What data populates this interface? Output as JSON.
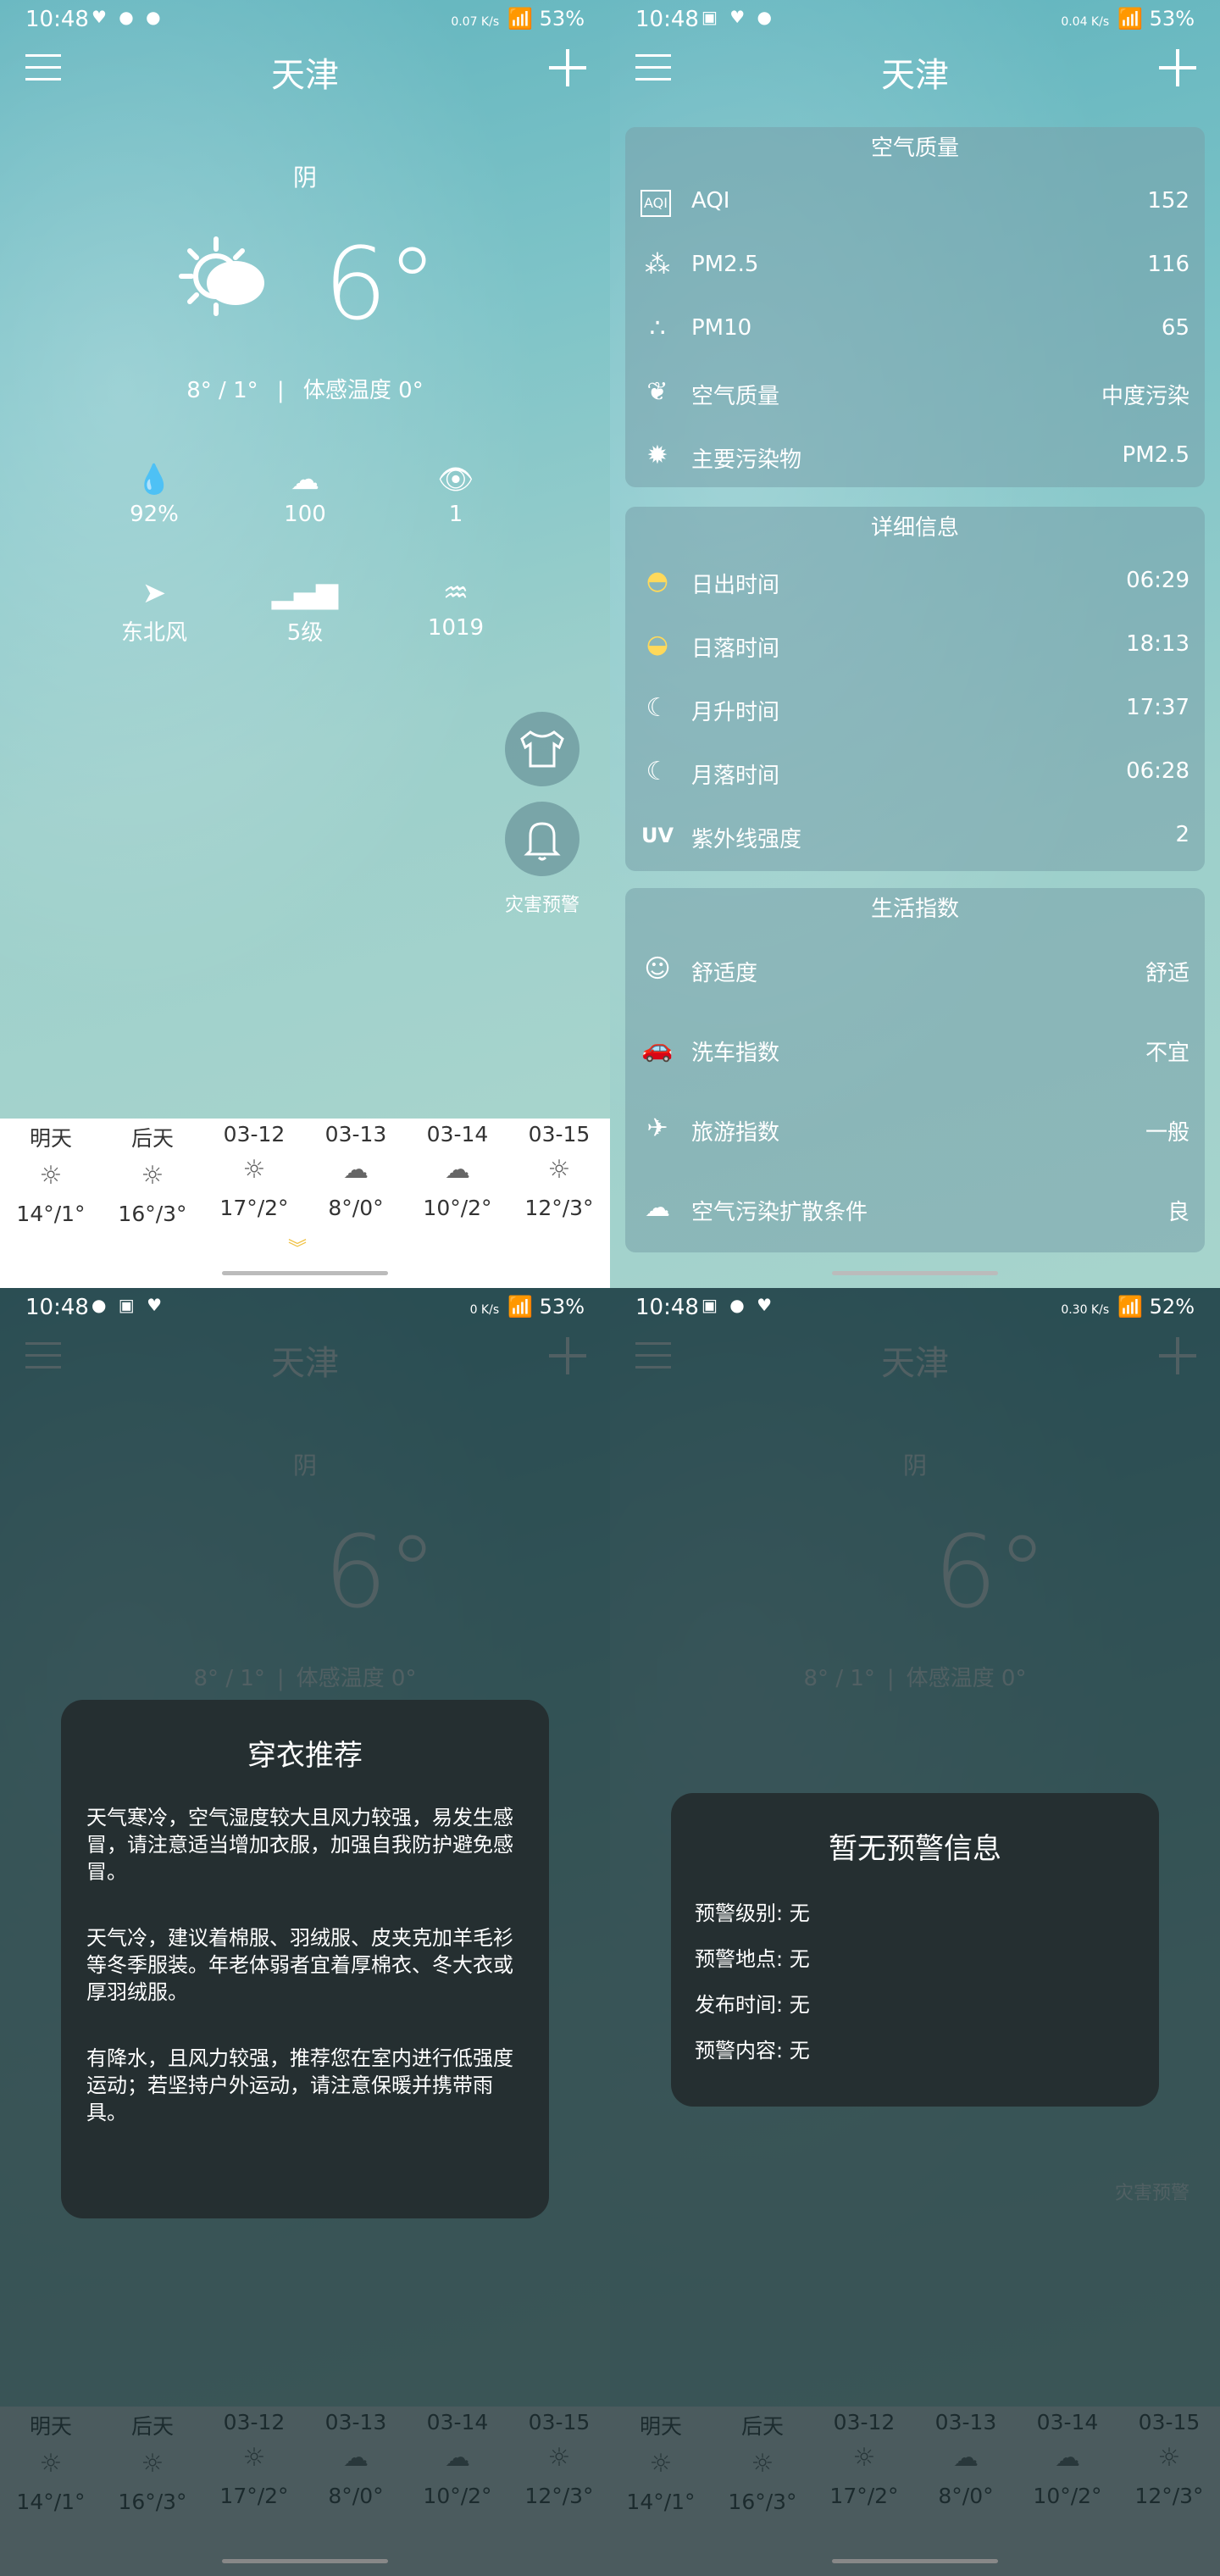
{
  "city": "天津",
  "condition": "阴",
  "temperature": "6°",
  "temp_range": "8° / 1°",
  "feels_like": "体感温度 0°",
  "stats": [
    {
      "icon": "humidity-icon",
      "value": "92%"
    },
    {
      "icon": "cloud-icon",
      "value": "100"
    },
    {
      "icon": "eye-icon",
      "value": "1"
    },
    {
      "icon": "wind-direction-icon",
      "value": "东北风"
    },
    {
      "icon": "signal-bars-icon",
      "value": "5级"
    },
    {
      "icon": "pressure-icon",
      "value": "1019"
    }
  ],
  "alert_label": "灾害预警",
  "forecast": [
    {
      "day": "明天",
      "weather": "sunny",
      "range": "14°/1°"
    },
    {
      "day": "后天",
      "weather": "sunny",
      "range": "16°/3°"
    },
    {
      "day": "03-12",
      "weather": "sunny",
      "range": "17°/2°"
    },
    {
      "day": "03-13",
      "weather": "cloudy",
      "range": "8°/0°"
    },
    {
      "day": "03-14",
      "weather": "cloudy",
      "range": "10°/2°"
    },
    {
      "day": "03-15",
      "weather": "sunny",
      "range": "12°/3°"
    }
  ],
  "status": [
    {
      "time": "10:48",
      "net": "0.07 K/s",
      "battery": "53%"
    },
    {
      "time": "10:48",
      "net": "0.04 K/s",
      "battery": "53%"
    },
    {
      "time": "10:48",
      "net": "0 K/s",
      "battery": "53%"
    },
    {
      "time": "10:48",
      "net": "0.30 K/s",
      "battery": "52%"
    }
  ],
  "air_quality": {
    "title": "空气质量",
    "rows": [
      {
        "icon": "aqi-icon",
        "label": "AQI",
        "value": "152"
      },
      {
        "icon": "pm25-icon",
        "label": "PM2.5",
        "value": "116"
      },
      {
        "icon": "pm10-icon",
        "label": "PM10",
        "value": "65"
      },
      {
        "icon": "leaf-icon",
        "label": "空气质量",
        "value": "中度污染"
      },
      {
        "icon": "pollutant-icon",
        "label": "主要污染物",
        "value": "PM2.5"
      }
    ]
  },
  "details": {
    "title": "详细信息",
    "rows": [
      {
        "icon": "sunrise-icon",
        "label": "日出时间",
        "value": "06:29"
      },
      {
        "icon": "sunset-icon",
        "label": "日落时间",
        "value": "18:13"
      },
      {
        "icon": "moonrise-icon",
        "label": "月升时间",
        "value": "17:37"
      },
      {
        "icon": "moonset-icon",
        "label": "月落时间",
        "value": "06:28"
      },
      {
        "icon": "uv-icon",
        "label": "紫外线强度",
        "value": "2"
      }
    ]
  },
  "life": {
    "title": "生活指数",
    "rows": [
      {
        "icon": "smile-icon",
        "label": "舒适度",
        "value": "舒适"
      },
      {
        "icon": "car-wash-icon",
        "label": "洗车指数",
        "value": "不宜"
      },
      {
        "icon": "plane-icon",
        "label": "旅游指数",
        "value": "一般"
      },
      {
        "icon": "diffusion-icon",
        "label": "空气污染扩散条件",
        "value": "良"
      }
    ]
  },
  "clothing_dialog": {
    "title": "穿衣推荐",
    "paragraphs": [
      "天气寒冷，空气湿度较大且风力较强，易发生感冒，请注意适当增加衣服，加强自我防护避免感冒。",
      "天气冷，建议着棉服、羽绒服、皮夹克加羊毛衫等冬季服装。年老体弱者宜着厚棉衣、冬大衣或厚羽绒服。",
      "有降水，且风力较强，推荐您在室内进行低强度运动；若坚持户外运动，请注意保暖并携带雨具。"
    ]
  },
  "warning_dialog": {
    "title": "暂无预警信息",
    "lines": [
      "预警级别: 无",
      "预警地点: 无",
      "发布时间: 无",
      "预警内容: 无"
    ]
  },
  "colors": {
    "teal": "#6dbcc3",
    "card": "#86aab2",
    "dialog": "#242e30",
    "chevron": "#f0c040"
  }
}
